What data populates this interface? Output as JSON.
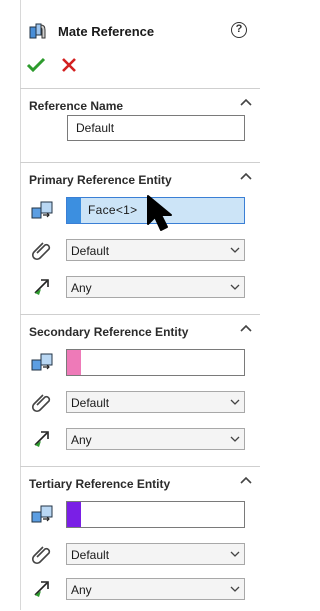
{
  "header": {
    "title": "Mate Reference",
    "help_label": "?"
  },
  "actions": {
    "ok_icon": "checkmark-icon",
    "cancel_icon": "cross-icon"
  },
  "colors": {
    "ok": "#2d9b2d",
    "cancel": "#d32020",
    "primary_swatch": "#3c8fe0",
    "secondary_swatch": "#ee7ab8",
    "tertiary_swatch": "#7a1fe6",
    "active_field_bg": "#cce4f7"
  },
  "reference_name": {
    "label": "Reference Name",
    "value": "Default"
  },
  "primary": {
    "label": "Primary Reference Entity",
    "entity": "Face<1>",
    "mate_type": "Default",
    "alignment": "Any"
  },
  "secondary": {
    "label": "Secondary Reference Entity",
    "entity": "",
    "mate_type": "Default",
    "alignment": "Any"
  },
  "tertiary": {
    "label": "Tertiary Reference Entity",
    "entity": "",
    "mate_type": "Default",
    "alignment": "Any"
  }
}
